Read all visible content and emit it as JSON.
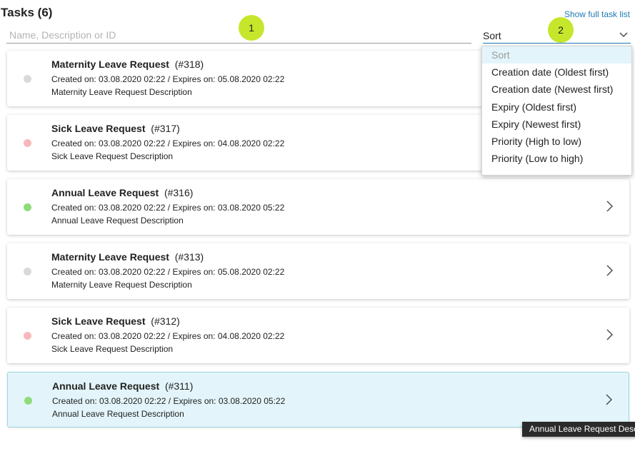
{
  "header": {
    "title": "Tasks (6)",
    "full_list_link": "Show full task list"
  },
  "search": {
    "placeholder": "Name, Description or ID",
    "value": ""
  },
  "sort": {
    "label": "Sort",
    "options": [
      "Sort",
      "Creation date (Oldest first)",
      "Creation date (Newest first)",
      "Expiry (Oldest first)",
      "Expiry (Newest first)",
      "Priority (High to low)",
      "Priority (Low to high)"
    ]
  },
  "badges": [
    "1",
    "2"
  ],
  "tasks": [
    {
      "name": "Maternity Leave Request",
      "id": "(#318)",
      "meta": "Created on: 03.08.2020 02:22 / Expires on: 05.08.2020 02:22",
      "description": "Maternity Leave Request Description",
      "status_color": "#d9d9d9"
    },
    {
      "name": "Sick Leave Request",
      "id": "(#317)",
      "meta": "Created on: 03.08.2020 02:22 / Expires on: 04.08.2020 02:22",
      "description": "Sick Leave Request Description",
      "status_color": "#f7b9bb"
    },
    {
      "name": "Annual Leave Request",
      "id": "(#316)",
      "meta": "Created on: 03.08.2020 02:22 / Expires on: 03.08.2020 05:22",
      "description": "Annual Leave Request Description",
      "status_color": "#8fdc7a"
    },
    {
      "name": "Maternity Leave Request",
      "id": "(#313)",
      "meta": "Created on: 03.08.2020 02:22 / Expires on: 05.08.2020 02:22",
      "description": "Maternity Leave Request Description",
      "status_color": "#d9d9d9"
    },
    {
      "name": "Sick Leave Request",
      "id": "(#312)",
      "meta": "Created on: 03.08.2020 02:22 / Expires on: 04.08.2020 02:22",
      "description": "Sick Leave Request Description",
      "status_color": "#f7b9bb"
    },
    {
      "name": "Annual Leave Request",
      "id": "(#311)",
      "meta": "Created on: 03.08.2020 02:22 / Expires on: 03.08.2020 05:22",
      "description": "Annual Leave Request Description",
      "status_color": "#8fdc7a"
    }
  ],
  "tooltip": "Annual Leave Request Description",
  "colors": {
    "accent": "#1e7ab5",
    "badge": "#c6e62c",
    "active_row": "#e3f5fa"
  },
  "icons": {
    "sort_chevron": "chevron-down-icon",
    "row_arrow": "chevron-right-icon"
  }
}
